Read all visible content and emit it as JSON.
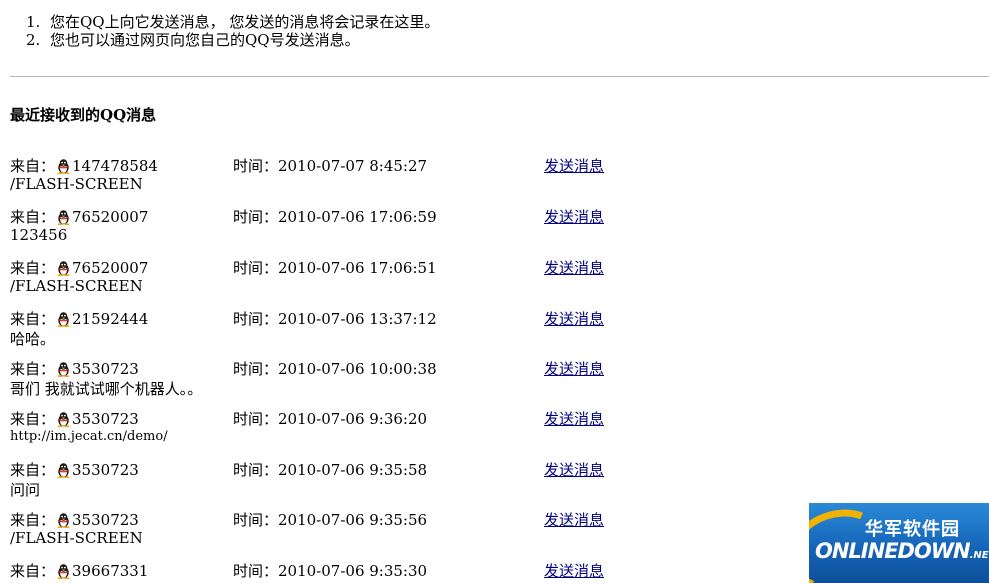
{
  "intro": [
    {
      "num": "1.",
      "text": "您在QQ上向它发送消息，   您发送的消息将会记录在这里。"
    },
    {
      "num": "2.",
      "text": "您也可以通过网页向您自己的QQ号发送消息。"
    }
  ],
  "heading": "最近接收到的QQ消息",
  "messages": [
    {
      "from_label": "来自：",
      "qq": "147478584",
      "time": "时间：2010-07-07 8:45:27",
      "send": "发送消息",
      "content": "/FLASH-SCREEN"
    },
    {
      "from_label": "来自：",
      "qq": "76520007",
      "time": "时间：2010-07-06 17:06:59",
      "send": "发送消息",
      "content": "123456"
    },
    {
      "from_label": "来自：",
      "qq": "76520007",
      "time": "时间：2010-07-06 17:06:51",
      "send": "发送消息",
      "content": "/FLASH-SCREEN"
    },
    {
      "from_label": "来自：",
      "qq": "21592444",
      "time": "时间：2010-07-06 13:37:12",
      "send": "发送消息",
      "content": "哈哈。"
    },
    {
      "from_label": "来自：",
      "qq": "3530723",
      "time": "时间：2010-07-06 10:00:38",
      "send": "发送消息",
      "content": "哥们 我就试试哪个机器人。。"
    },
    {
      "from_label": "来自：",
      "qq": "3530723",
      "time": "时间：2010-07-06 9:36:20",
      "send": "发送消息",
      "content": "http://im.jecat.cn/demo/"
    },
    {
      "from_label": "来自：",
      "qq": "3530723",
      "time": "时间：2010-07-06 9:35:58",
      "send": "发送消息",
      "content": "问问"
    },
    {
      "from_label": "来自：",
      "qq": "3530723",
      "time": "时间：2010-07-06 9:35:56",
      "send": "发送消息",
      "content": "/FLASH-SCREEN"
    },
    {
      "from_label": "来自：",
      "qq": "39667331",
      "time": "时间：2010-07-06 9:35:30",
      "send": "发送消息",
      "content": ""
    }
  ],
  "icons": {
    "qq": "qq-penguin-icon"
  },
  "colors": {
    "link": "#000080",
    "watermark_bg": "#1565b8",
    "watermark_accent": "#f2b300"
  },
  "watermark": {
    "cn": "华军软件园",
    "en": "ONLINEDOWN",
    "en_suffix": ".NET"
  }
}
